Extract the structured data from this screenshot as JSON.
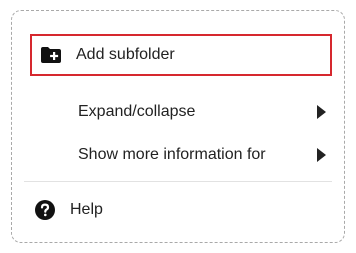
{
  "menu": {
    "items": [
      {
        "label": "Add subfolder",
        "icon": "folder-plus-icon",
        "highlighted": true
      },
      {
        "label": "Expand/collapse",
        "submenu": true
      },
      {
        "label": "Show more information for",
        "submenu": true
      },
      {
        "label": "Help",
        "icon": "help-circle-icon"
      }
    ],
    "highlight_color": "#d6282e"
  }
}
